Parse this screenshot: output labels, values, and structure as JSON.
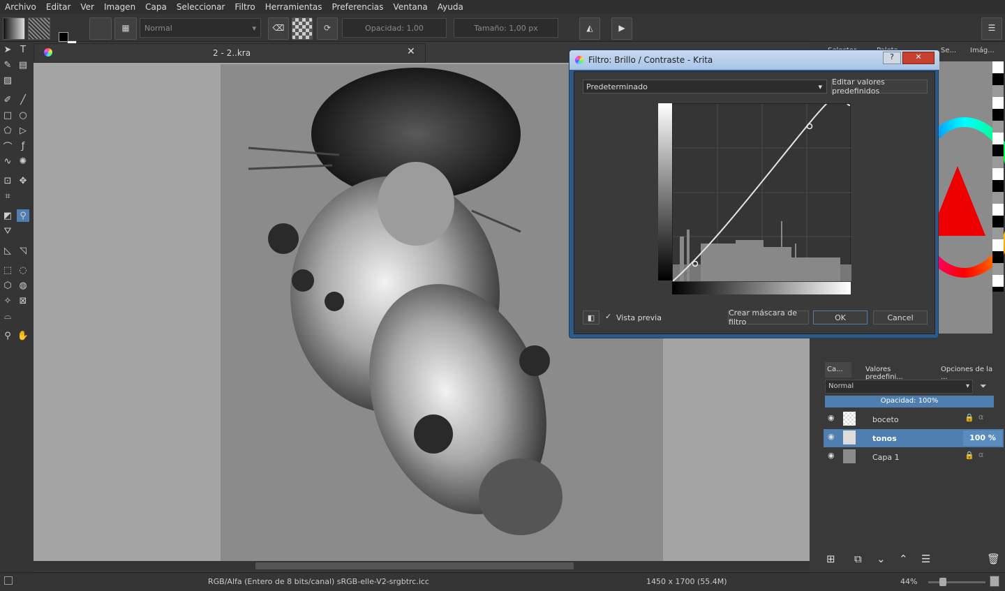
{
  "menu": [
    "Archivo",
    "Editar",
    "Ver",
    "Imagen",
    "Capa",
    "Seleccionar",
    "Filtro",
    "Herramientas",
    "Preferencias",
    "Ventana",
    "Ayuda"
  ],
  "toolbar": {
    "blend_mode": "Normal",
    "opacity_label": "Opacidad:  1,00",
    "size_label": "Tamaño:  1,00 px"
  },
  "document": {
    "tab_title": "2 - 2..kra"
  },
  "dialog": {
    "title": "Filtro: Brillo / Contraste - Krita",
    "preset": "Predeterminado",
    "edit_presets": "Editar valores predefinidos",
    "preview_label": "Vista previa",
    "create_mask": "Crear máscara de filtro",
    "ok": "OK",
    "cancel": "Cancel",
    "help_btn": "?",
    "close_btn": "✕"
  },
  "dock_tabs_top": [
    "Selector de...",
    "Paleta...",
    "Se...",
    "Imág..."
  ],
  "dock_tabs_bottom": [
    "Ca...",
    "Valores predefini...",
    "Opciones de la ..."
  ],
  "layers": {
    "blend_mode": "Normal",
    "opacity": "Opacidad:  100%",
    "items": [
      {
        "name": "boceto",
        "opacity": ""
      },
      {
        "name": "tonos",
        "opacity": "100 %"
      },
      {
        "name": "Capa 1",
        "opacity": ""
      }
    ]
  },
  "status": {
    "color_info": "RGB/Alfa (Entero de 8 bits/canal)  sRGB-elle-V2-srgbtrc.icc",
    "image_size": "1450 x 1700 (55.4M)",
    "zoom": "44%"
  },
  "colors": {
    "accent": "#4f7fb0",
    "selected_layer": "#4f7fb0",
    "canvas_bg": "#a4a4a4"
  }
}
